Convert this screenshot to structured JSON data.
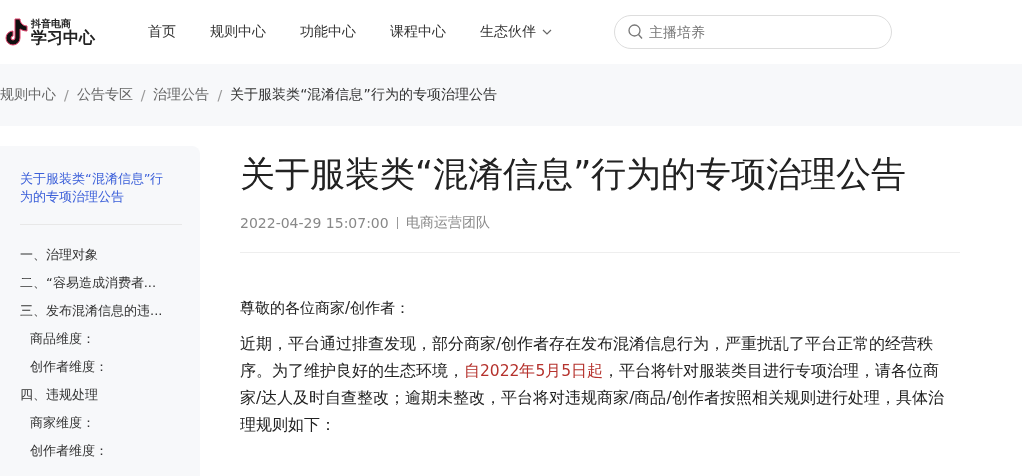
{
  "header": {
    "logo_small": "抖音电商",
    "logo_main": "学习中心",
    "nav": [
      {
        "label": "首页",
        "dropdown": false
      },
      {
        "label": "规则中心",
        "dropdown": false
      },
      {
        "label": "功能中心",
        "dropdown": false
      },
      {
        "label": "课程中心",
        "dropdown": false
      },
      {
        "label": "生态伙伴",
        "dropdown": true
      }
    ],
    "search": {
      "placeholder": "主播培养"
    }
  },
  "breadcrumb": [
    {
      "label": "规则中心"
    },
    {
      "separator": "/",
      "label": "公告专区"
    },
    {
      "separator": "/",
      "label": "治理公告"
    },
    {
      "separator": "/",
      "label": "关于服装类“混淆信息”行为的专项治理公告"
    }
  ],
  "toc": {
    "title": "关于服装类“混淆信息”行为的专项治理公告",
    "items": [
      {
        "label": "一、治理对象"
      },
      {
        "label": "二、“容易造成消费者..."
      },
      {
        "label": "三、发布混淆信息的违...",
        "children": [
          {
            "label": "商品维度："
          },
          {
            "label": "创作者维度："
          }
        ]
      },
      {
        "label": "四、违规处理",
        "children": [
          {
            "label": "商家维度："
          },
          {
            "label": "创作者维度："
          }
        ]
      }
    ]
  },
  "article": {
    "title": "关于服装类“混淆信息”行为的专项治理公告",
    "date": "2022-04-29 15:07:00",
    "author": "电商运营团队",
    "salutation": "尊敬的各位商家/创作者：",
    "paragraph": [
      {
        "text": "近期，平台通过排查发现，部分商家/创作者存在发布混淆信息行为，严重扰乱了平台正常的经营秩序。为了维护良好的生态环境，",
        "highlight": false
      },
      {
        "text": "自2022年5月5日起",
        "highlight": true
      },
      {
        "text": "，平台将针对服装类目进行专项治理，请各位商家/达人及时自查整改；逾期未整改，平台将对违规商家/商品/创作者按照相关规则进行处理，具体治理规则如下：",
        "highlight": false
      }
    ]
  }
}
